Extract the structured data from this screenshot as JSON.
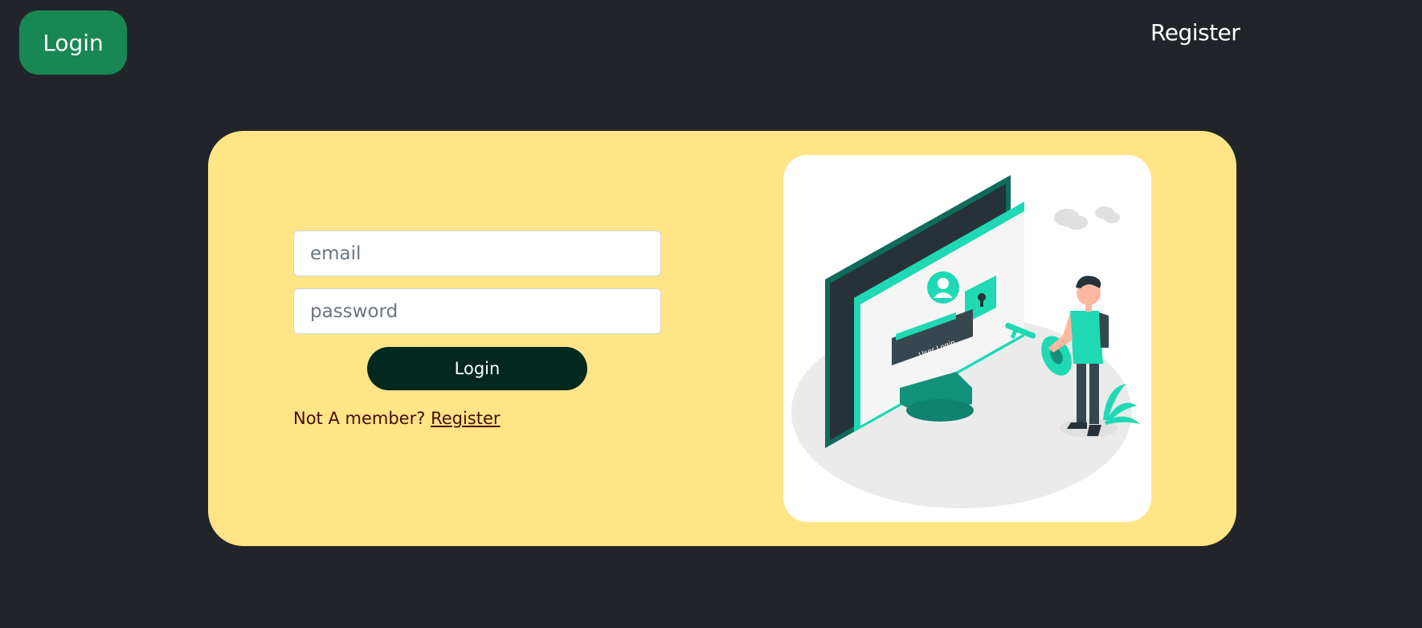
{
  "nav": {
    "login_label": "Login",
    "register_label": "Register"
  },
  "form": {
    "email_placeholder": "email",
    "password_placeholder": "password",
    "submit_label": "Login",
    "member_prompt": "Not A member?",
    "register_link": "Register"
  },
  "illustration": {
    "screen_label": "User Login"
  },
  "colors": {
    "background": "#212529",
    "nav_login_bg": "#198754",
    "card_bg": "#ffe585",
    "submit_bg": "#02281f",
    "accent_teal": "#1ed9b4"
  }
}
